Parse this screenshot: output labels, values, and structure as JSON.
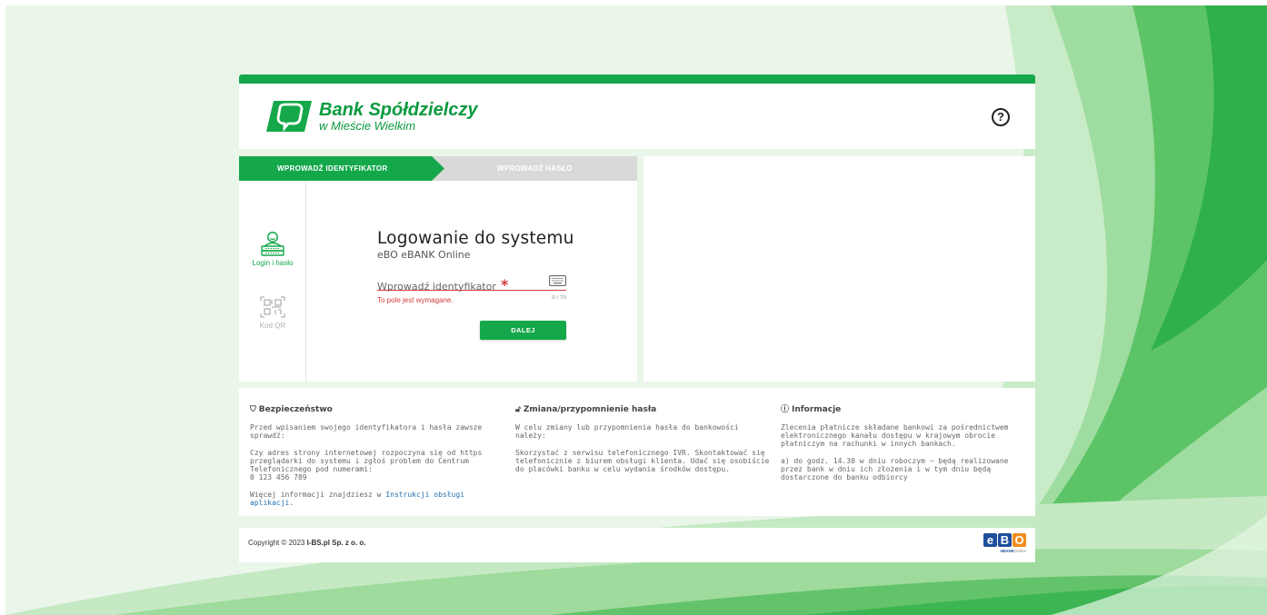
{
  "header": {
    "bank_name": "Bank Spółdzielczy",
    "bank_location": "w Mieście Wielkim",
    "help_symbol": "?"
  },
  "steps": {
    "step1": "WPROWADŹ IDENTYFIKATOR",
    "step2": "WPROWADŹ HASŁO"
  },
  "methods": {
    "login_label": "Login i hasło",
    "qr_label": "Kod QR"
  },
  "form": {
    "title": "Logowanie do systemu",
    "subtitle": "eBO eBANK Online",
    "field_placeholder": "Wprowadź identyfikator",
    "required_mark": "*",
    "counter": "0 / 70",
    "error": "To pole jest wymagane.",
    "next_button": "DALEJ"
  },
  "info": {
    "security": {
      "heading": "Bezpieczeństwo",
      "p1": "Przed wpisaniem swojego identyfikatora i hasła zawsze sprawdź:",
      "p2": "Czy adres strony internetowej rozpoczyna się od https przeglądarki do systemu i zgłoś problem do Centrum Telefonicznego pod numerami:",
      "phone": "0 123 456 789",
      "more_prefix": "Więcej informacji znajdziesz w ",
      "more_link": "Instrukcji obsługi aplikacji",
      "more_suffix": "."
    },
    "password": {
      "heading": "Zmiana/przypomnienie hasła",
      "p1": "W celu zmiany lub przypomnienia hasła do bankowości należy:",
      "p2": "Skorzystać z serwisu telefonicznego IVR. Skontaktować się telefonicznie z biurem obsługi klienta. Udać się osobiście do placówki banku w celu wydania środków dostępu."
    },
    "information": {
      "heading": "Informacje",
      "p1": "Zlecenia płatnicze składane bankowi za pośrednictwem elektronicznego kanału dostępu w krajowym obrocie płatniczym na rachunki w innych bankach.",
      "p2": "a) do godz. 14.30 w dniu roboczym – będą realizowane przez bank w dniu ich złożenia i w tym dniu będą dostarczone do banku odbiorcy"
    }
  },
  "footer": {
    "copyright_prefix": "Copyright © 2023 ",
    "copyright_company": "I-BS.pl Sp. z o. o.",
    "ebo_letters": [
      "e",
      "B",
      "O"
    ],
    "ebo_tag_bold": "eBANK",
    "ebo_tag_rest": "Online"
  },
  "colors": {
    "brand_green": "#14a84a",
    "error_red": "#d33b3b",
    "step_inactive": "#d9d9d9",
    "ebo_blue": "#1f4f9c",
    "ebo_orange": "#f28b1b"
  }
}
